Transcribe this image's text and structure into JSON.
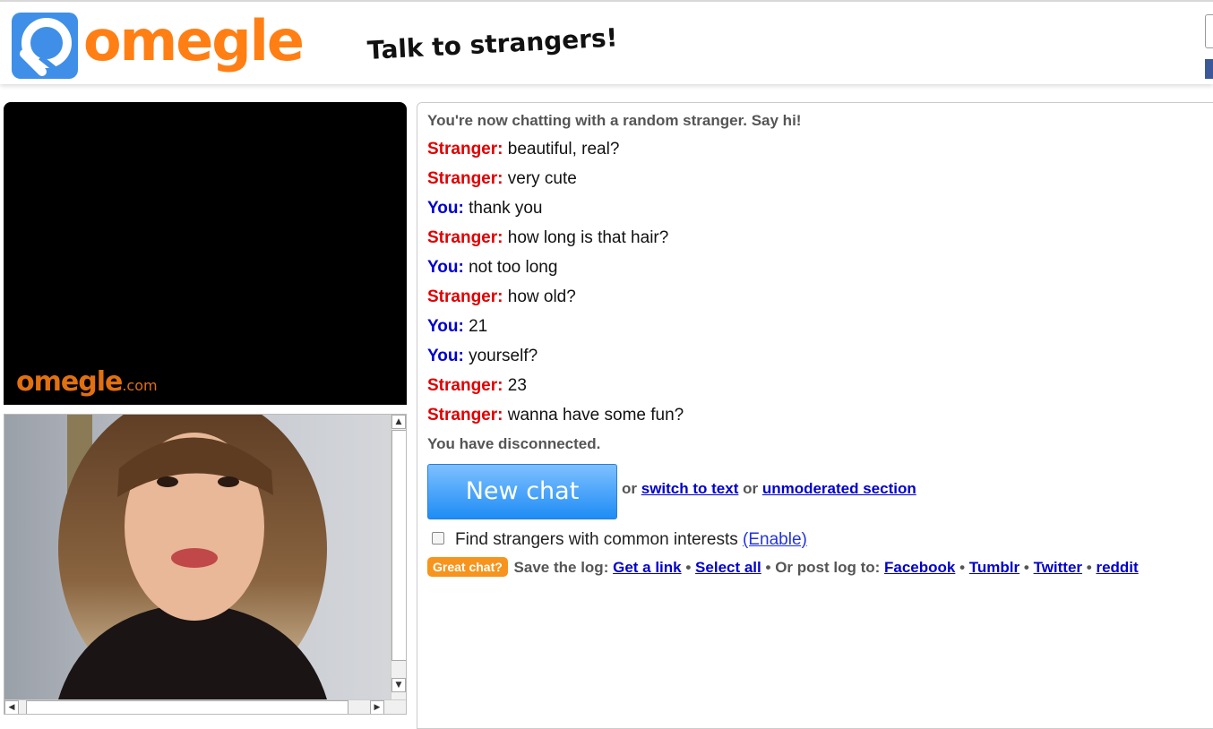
{
  "header": {
    "logo_text": "omegle",
    "tagline": "Talk to strangers!"
  },
  "stranger_video": {
    "watermark": "omegle",
    "watermark_suffix": ".com"
  },
  "chat": {
    "intro": "You're now chatting with a random stranger. Say hi!",
    "messages": [
      {
        "who": "Stranger:",
        "text": "beautiful, real?"
      },
      {
        "who": "Stranger:",
        "text": "very cute"
      },
      {
        "who": "You:",
        "text": "thank you"
      },
      {
        "who": "Stranger:",
        "text": "how long is that hair?"
      },
      {
        "who": "You:",
        "text": "not too long"
      },
      {
        "who": "Stranger:",
        "text": "how old?"
      },
      {
        "who": "You:",
        "text": "21"
      },
      {
        "who": "You:",
        "text": "yourself?"
      },
      {
        "who": "Stranger:",
        "text": "23"
      },
      {
        "who": "Stranger:",
        "text": "wanna have some fun?"
      }
    ],
    "disconnected": "You have disconnected."
  },
  "controls": {
    "new_chat_label": "New chat",
    "or_1": "or",
    "switch_to_text": "switch to text",
    "or_2": "or",
    "unmoderated_section": "unmoderated section",
    "interests_label": "Find strangers with common interests",
    "enable_label": "(Enable)",
    "great_chat_label": "Great chat?",
    "save_log_label": "Save the log:",
    "get_link": "Get a link",
    "bullet": "•",
    "select_all": "Select all",
    "post_log_label": "Or post log to:",
    "facebook": "Facebook",
    "tumblr": "Tumblr",
    "twitter": "Twitter",
    "reddit": "reddit"
  },
  "colors": {
    "brand_orange": "#ff7f14",
    "stranger_red": "#e00000",
    "you_blue": "#0000cc",
    "new_chat_blue": "#1e8cf5",
    "great_chat_orange": "#f7941d"
  }
}
